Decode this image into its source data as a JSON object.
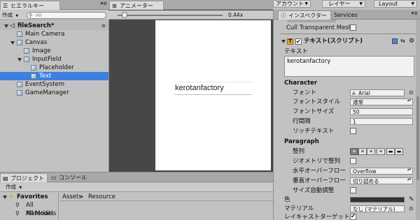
{
  "toolbar": {
    "account": "アカウント",
    "layers": "レイヤー",
    "layout": "Layout"
  },
  "hierarchy": {
    "tab": "ヒエラルキー",
    "create": "作成",
    "search_placeholder": "All",
    "scene": "fileSearch*",
    "items": [
      {
        "label": "Main Camera"
      },
      {
        "label": "Canvas"
      },
      {
        "label": "Image"
      },
      {
        "label": "InputField"
      },
      {
        "label": "Placeholder"
      },
      {
        "label": "Text"
      },
      {
        "label": "EventSystem"
      },
      {
        "label": "GameManager"
      }
    ]
  },
  "animator": {
    "tab": "アニメーター",
    "zoom": "0.44x"
  },
  "scene_view": {
    "input_text": "kerotanfactory"
  },
  "project": {
    "tab": "プロジェクト",
    "console_tab": "コンソール",
    "create": "作成",
    "favorites": "Favorites",
    "fav_items": [
      "All Materials",
      "All Models"
    ],
    "breadcrumb_assets": "Assets",
    "breadcrumb_sep": "▸",
    "breadcrumb_resources": "Resource"
  },
  "inspector": {
    "tab": "インスペクター",
    "services_tab": "Services",
    "cull_label": "Cull Transparent Mesh",
    "component_title": "テキスト(スクリプト)",
    "text_label": "テキスト",
    "text_value": "kerotanfactory",
    "character_header": "Character",
    "font_label": "フォント",
    "font_value": "Arial",
    "font_style_label": "フォントスタイル",
    "font_style_value": "通常",
    "font_size_label": "フォントサイズ",
    "font_size_value": "50",
    "line_spacing_label": "行間隔",
    "line_spacing_value": "1",
    "rich_text_label": "リッチテキスト",
    "paragraph_header": "Paragraph",
    "alignment_label": "整列",
    "geometry_label": "ジオメトリで整列",
    "h_overflow_label": "水平オーバーフロー",
    "h_overflow_value": "Overflow",
    "v_overflow_label": "垂直オーバーフロー",
    "v_overflow_value": "切り詰める",
    "best_fit_label": "サイズ自動調整",
    "color_label": "色",
    "material_label": "マテリアル",
    "material_value": "なし (マテリアル)",
    "raycast_label": "レイキャストターゲット"
  },
  "colors": {
    "selection": "#3d80df",
    "panel_bg": "#c2c2c2",
    "dark_view": "#474747",
    "text_color_swatch": "#323232"
  }
}
